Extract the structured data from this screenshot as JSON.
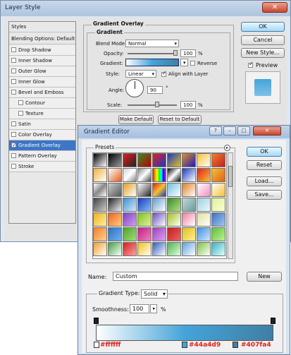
{
  "layer_style": {
    "title": "Layer Style",
    "close_label": "✕",
    "styles_header": "Styles",
    "blending_options": "Blending Options: Default",
    "effects": [
      {
        "label": "Drop Shadow",
        "checked": false
      },
      {
        "label": "Inner Shadow",
        "checked": false
      },
      {
        "label": "Outer Glow",
        "checked": false
      },
      {
        "label": "Inner Glow",
        "checked": false
      },
      {
        "label": "Bevel and Emboss",
        "checked": false
      },
      {
        "label": "Contour",
        "checked": false
      },
      {
        "label": "Texture",
        "checked": false
      },
      {
        "label": "Satin",
        "checked": false
      },
      {
        "label": "Color Overlay",
        "checked": false
      },
      {
        "label": "Gradient Overlay",
        "checked": true,
        "selected": true
      },
      {
        "label": "Pattern Overlay",
        "checked": false
      },
      {
        "label": "Stroke",
        "checked": false
      }
    ],
    "panel_title": "Gradient Overlay",
    "group_title": "Gradient",
    "blend_mode_label": "Blend Mode:",
    "blend_mode_value": "Normal",
    "opacity_label": "Opacity:",
    "opacity_value": "100",
    "opacity_unit": "%",
    "gradient_label": "Gradient:",
    "reverse_label": "Reverse",
    "style_label": "Style:",
    "style_value": "Linear",
    "align_label": "Align with Layer",
    "angle_label": "Angle:",
    "angle_value": "90",
    "angle_unit": "°",
    "scale_label": "Scale:",
    "scale_value": "100",
    "scale_unit": "%",
    "make_default": "Make Default",
    "reset_default": "Reset to Default",
    "ok": "OK",
    "cancel": "Cancel",
    "new_style": "New Style...",
    "preview_label": "Preview"
  },
  "gradient_editor": {
    "title": "Gradient Editor",
    "presets_label": "Presets",
    "ok": "OK",
    "reset": "Reset",
    "load": "Load...",
    "save": "Save...",
    "name_label": "Name:",
    "name_value": "Custom",
    "new_label": "New",
    "gradient_type_label": "Gradient Type:",
    "gradient_type_value": "Solid",
    "smoothness_label": "Smoothness:",
    "smoothness_value": "100",
    "smoothness_unit": "%",
    "stop_labels": [
      "#ffffff",
      "#44a4d9",
      "#407fa4"
    ],
    "stop_colors": [
      "#ffffff",
      "#44a4d9",
      "#407fa4"
    ],
    "annotation_color": "#e0201a"
  }
}
